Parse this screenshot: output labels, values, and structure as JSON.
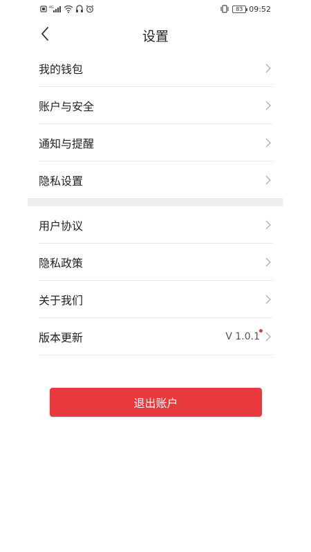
{
  "status_bar": {
    "left_icons": [
      "sim-icon",
      "signal-4g-icon",
      "wifi-icon",
      "headset-icon",
      "alarm-icon"
    ],
    "network_label": "4G",
    "battery_level": "83",
    "time": "09:52"
  },
  "header": {
    "title": "设置"
  },
  "settings_group_1": [
    {
      "label": "我的钱包"
    },
    {
      "label": "账户与安全"
    },
    {
      "label": "通知与提醒"
    },
    {
      "label": "隐私设置"
    }
  ],
  "settings_group_2": [
    {
      "label": "用户协议"
    },
    {
      "label": "隐私政策"
    },
    {
      "label": "关于我们"
    },
    {
      "label": "版本更新",
      "value": "V 1.0.1",
      "has_update_dot": true
    }
  ],
  "logout": {
    "label": "退出账户"
  },
  "colors": {
    "accent": "#e8393d",
    "divider": "#e6e6e6",
    "section_gap": "#efefef"
  }
}
